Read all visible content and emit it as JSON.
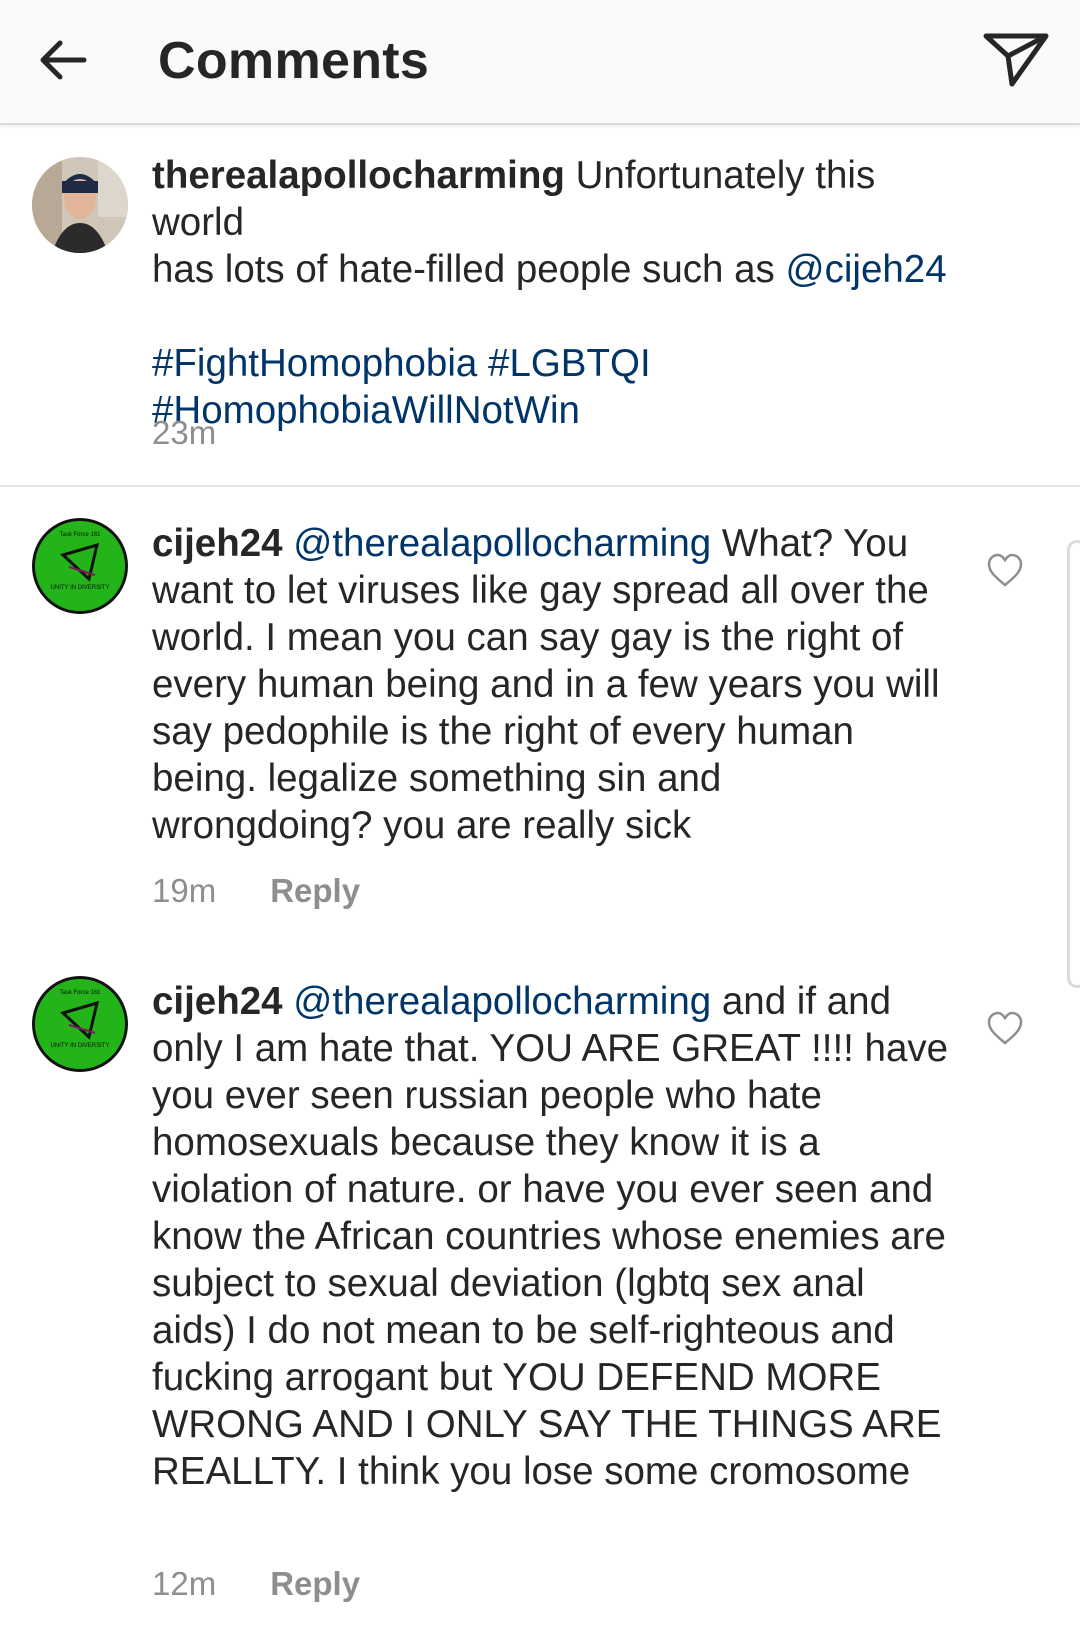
{
  "header": {
    "title": "Comments"
  },
  "caption": {
    "username": "therealapollocharming",
    "text_line1": "Unfortunately this world",
    "text_line2_prefix": "has lots of hate-filled people such as ",
    "mention": "@cijeh24",
    "hashtags": [
      "#FightHomophobia",
      "#LGBTQI",
      "#HomophobiaWillNotWin"
    ],
    "time": "23m"
  },
  "comments": [
    {
      "username": "cijeh24",
      "mention": "@therealapollocharming",
      "text": "What? You want to let viruses like gay spread all over the world. I mean you can say gay is the right of every human being and in a few years you will say pedophile is the right of every human being. legalize something sin and wrongdoing? you are really sick",
      "time": "19m",
      "reply_label": "Reply",
      "avatar_text_top": "Task Force 161",
      "avatar_text_bottom": "UNITY IN DIVERSITY"
    },
    {
      "username": "cijeh24",
      "mention": "@therealapollocharming",
      "text": "and if and only I am hate that. YOU ARE GREAT !!!! have you ever seen russian people who hate homosexuals because they know it is a violation of nature. or have you ever seen and know the African countries whose enemies are subject to sexual deviation (lgbtq sex anal aids) I do not mean to be self-righteous and fucking arrogant but YOU DEFEND MORE  WRONG AND I ONLY SAY THE THINGS ARE REALLTY. I think you lose some cromosome",
      "time": "12m",
      "reply_label": "Reply",
      "avatar_text_top": "Task Force 161",
      "avatar_text_bottom": "UNITY IN DIVERSITY"
    }
  ],
  "colors": {
    "link": "#003569",
    "meta": "#8e8e8e",
    "avatar_green": "#22b418"
  }
}
